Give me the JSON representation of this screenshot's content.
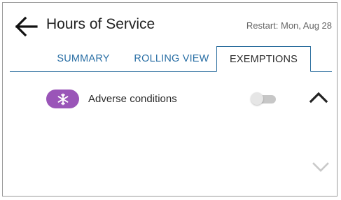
{
  "header": {
    "title": "Hours of Service",
    "restart_text": "Restart: Mon, Aug 28",
    "back_icon": "arrow-left-icon"
  },
  "tabs": [
    {
      "label": "SUMMARY",
      "active": false
    },
    {
      "label": "ROLLING VIEW",
      "active": false
    },
    {
      "label": "EXEMPTIONS",
      "active": true
    }
  ],
  "exemptions": [
    {
      "icon": "snowflake-icon",
      "badge_color": "#9a55b8",
      "label": "Adverse conditions",
      "enabled": false
    }
  ],
  "scroll": {
    "up_icon": "chevron-up-icon",
    "down_icon": "chevron-down-icon"
  },
  "colors": {
    "accent": "#2a6fa5",
    "text": "#2b2b2b",
    "muted": "#666666",
    "badge": "#9a55b8",
    "toggle_off_track": "#c7c7c7",
    "chevron_disabled": "#c9c9c9"
  }
}
